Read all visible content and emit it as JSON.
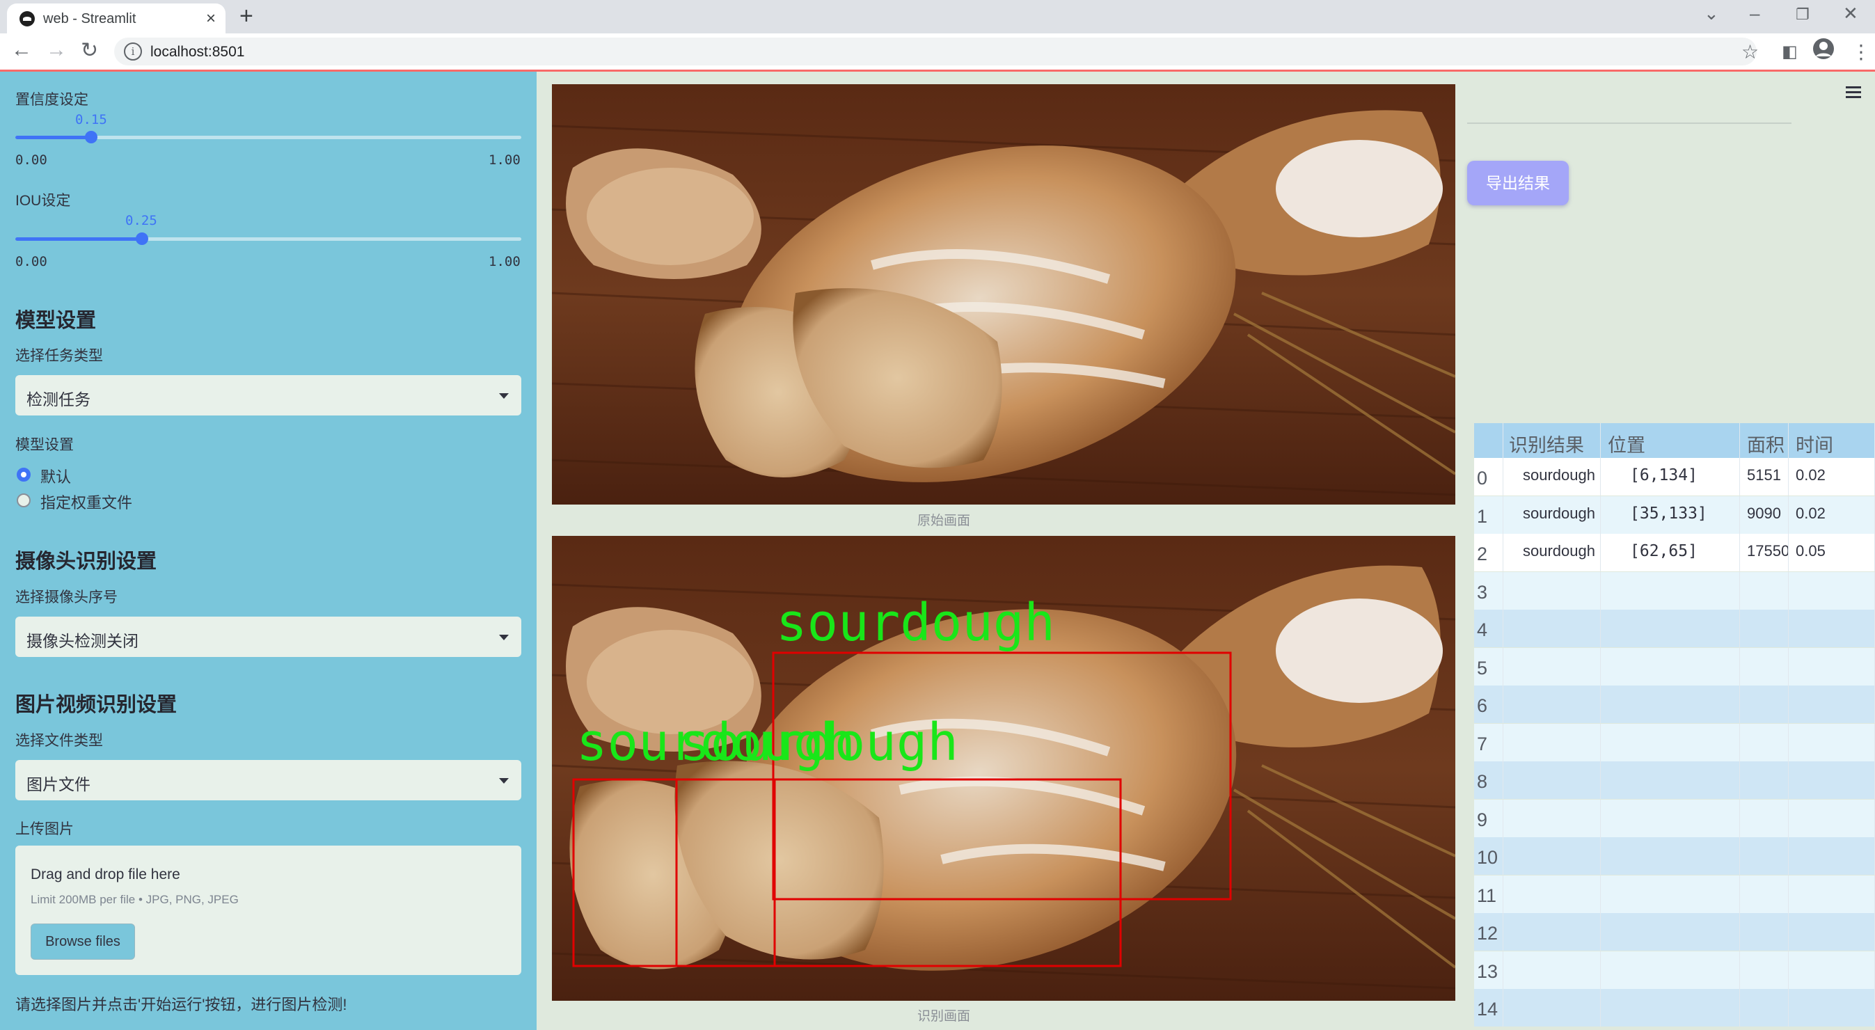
{
  "browser": {
    "tab_title": "web - Streamlit",
    "url": "localhost:8501"
  },
  "sidebar": {
    "confidence": {
      "label": "置信度设定",
      "value": "0.15",
      "min": "0.00",
      "max": "1.00",
      "fraction": 0.15
    },
    "iou": {
      "label": "IOU设定",
      "value": "0.25",
      "min": "0.00",
      "max": "1.00",
      "fraction": 0.25
    },
    "model_header": "模型设置",
    "task_label": "选择任务类型",
    "task_value": "检测任务",
    "model_label": "模型设置",
    "model_options": [
      "默认",
      "指定权重文件"
    ],
    "model_selected": "默认",
    "camera_header": "摄像头识别设置",
    "camera_label": "选择摄像头序号",
    "camera_value": "摄像头检测关闭",
    "media_header": "图片视频识别设置",
    "file_type_label": "选择文件类型",
    "file_type_value": "图片文件",
    "upload_label": "上传图片",
    "upload_drag": "Drag and drop file here",
    "upload_limit": "Limit 200MB per file • JPG, PNG, JPEG",
    "browse_label": "Browse files",
    "hint": "请选择图片并点击'开始运行'按钮，进行图片检测!"
  },
  "main": {
    "original_caption": "原始画面",
    "result_caption": "识别画面",
    "detection_labels": [
      "sourdough",
      "sourdough",
      "sourdough"
    ],
    "export_label": "导出结果"
  },
  "table": {
    "headers": [
      "识别结果",
      "位置",
      "面积",
      "时间"
    ],
    "rows": [
      {
        "idx": "0",
        "label": "sourdough",
        "pos": "[6,134]",
        "area": "5151",
        "time": "0.02"
      },
      {
        "idx": "1",
        "label": "sourdough",
        "pos": "[35,133]",
        "area": "9090",
        "time": "0.02"
      },
      {
        "idx": "2",
        "label": "sourdough",
        "pos": "[62,65]",
        "area": "17550",
        "time": "0.05"
      }
    ],
    "empty_idx": [
      "3",
      "4",
      "5",
      "6",
      "7",
      "8",
      "9",
      "10",
      "11",
      "12",
      "13",
      "14"
    ]
  },
  "colors": {
    "sidebar_bg": "#7ac6db",
    "main_bg": "#dfe9dd",
    "accent": "#3f73f6",
    "box": "#e00000",
    "det_text": "#19e619",
    "export_bg": "#a4a6f8"
  }
}
